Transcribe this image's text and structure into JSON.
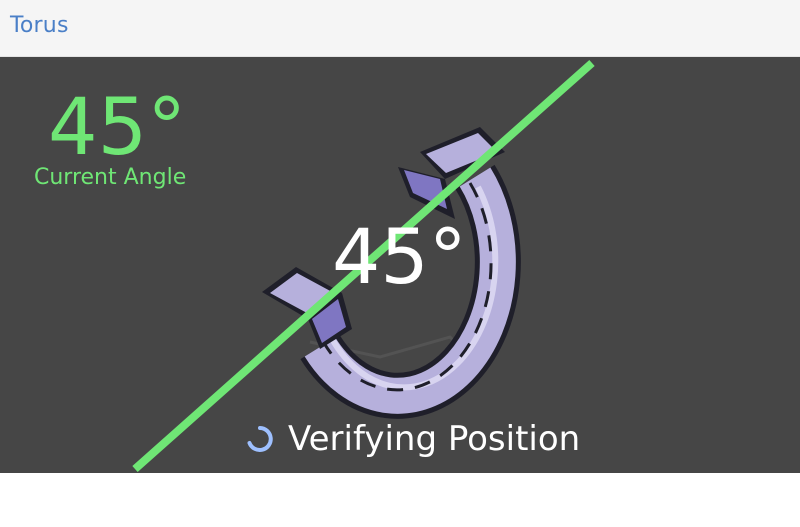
{
  "header": {
    "title": "Torus"
  },
  "readout": {
    "angle": "45°",
    "label": "Current Angle"
  },
  "device": {
    "angle": "45°",
    "angle_value_deg": 45,
    "icon": "torus-arc-device-icon"
  },
  "status": {
    "text": "Verifying Position",
    "icon": "spinner-icon"
  },
  "colors": {
    "header_bg": "#f5f5f5",
    "title": "#4a7fc7",
    "stage_bg": "#464646",
    "accent_green": "#6fe675",
    "device_body": "#b6b0dc",
    "device_shadow": "#7f76c2",
    "outline": "#1f1f2a",
    "spinner": "#9ec0ff"
  }
}
